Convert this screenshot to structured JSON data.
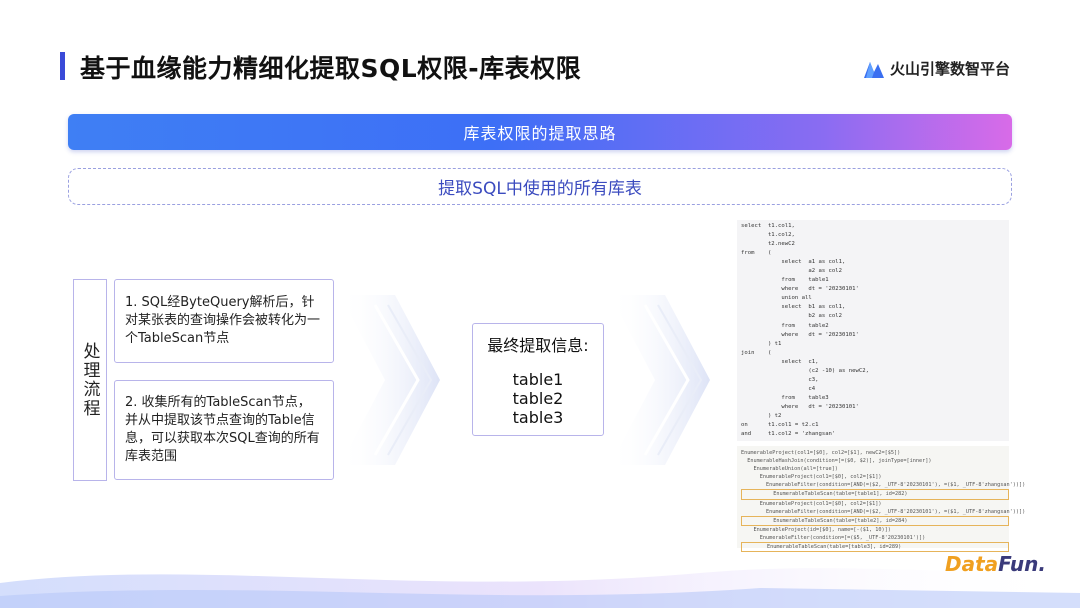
{
  "header": {
    "title": "基于血缘能力精细化提取SQL权限-库表权限",
    "brand": "火山引擎数智平台"
  },
  "banner": {
    "label": "库表权限的提取思路"
  },
  "subbanner": {
    "label": "提取SQL中使用的所有库表"
  },
  "process": {
    "label": "处理流程",
    "steps": [
      {
        "text": "1. SQL经ByteQuery解析后，针对某张表的查询操作会被转化为一个TableScan节点"
      },
      {
        "text": "2. 收集所有的TableScan节点，并从中提取该节点查询的Table信息，可以获取本次SQL查询的所有库表范围"
      }
    ]
  },
  "result": {
    "title": "最终提取信息:",
    "tables": [
      "table1",
      "table2",
      "table3"
    ]
  },
  "sql_code": [
    "select  t1.col1,",
    "        t1.col2,",
    "        t2.newC2",
    "from    (",
    "            select  a1 as col1,",
    "                    a2 as col2",
    "            from    table1",
    "            where   dt = '20230101'",
    "            union all",
    "            select  b1 as col1,",
    "                    b2 as col2",
    "            from    table2",
    "            where   dt = '20230101'",
    "        ) t1",
    "join    (",
    "            select  c1,",
    "                    (c2 -10) as newC2,",
    "                    c3,",
    "                    c4",
    "            from    table3",
    "            where   dt = '20230101'",
    "        ) t2",
    "on      t1.col1 = t2.c1",
    "and     t1.col2 = 'zhangsan'"
  ],
  "plan_code": [
    "EnumerableProject(col1=[$0], col2=[$1], newC2=[$5])",
    "  EnumerableHashJoin(condition=[=($0, $2)], joinType=[inner])",
    "    EnumerableUnion(all=[true])",
    "      EnumerableProject(col1=[$0], col2=[$1])",
    "        EnumerableFilter(condition=[AND(=($2, _UTF-8'20230101'), =($1, _UTF-8'zhangsan'))])",
    "          EnumerableTableScan(table=[table1], id=282)",
    "      EnumerableProject(col1=[$0], col2=[$1])",
    "        EnumerableFilter(condition=[AND(=($2, _UTF-8'20230101'), =($1, _UTF-8'zhangsan'))])",
    "          EnumerableTableScan(table=[table2], id=284)",
    "    EnumerableProject(id=[$0], name=[-($1, 10)])",
    "      EnumerableFilter(condition=[=($5, _UTF-8'20230101')])",
    "        EnumerableTableScan(table=[table3], id=289)"
  ],
  "footer": {
    "logo_a": "Data",
    "logo_b": "Fun."
  },
  "colors": {
    "accent": "#3a4ad8",
    "border": "#b8b4ea"
  }
}
